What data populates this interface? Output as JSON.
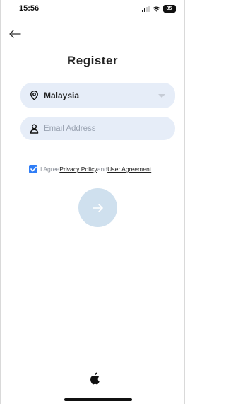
{
  "status_bar": {
    "time": "15:56",
    "battery": "85",
    "icons": [
      "signal-icon",
      "wifi-icon",
      "battery-icon"
    ]
  },
  "header": {
    "back_icon": "arrow-left-icon",
    "title": "Register"
  },
  "form": {
    "country": {
      "icon": "location-pin-icon",
      "value": "Malaysia",
      "caret_icon": "caret-down-icon"
    },
    "email": {
      "icon": "user-icon",
      "placeholder": "Email Address",
      "value": ""
    }
  },
  "agreement": {
    "checked": true,
    "prefix": "I Agree",
    "privacy_link": "Privacy Policy",
    "connector": "and",
    "user_agreement_link": "User Agreement"
  },
  "actions": {
    "next_icon": "arrow-right-icon",
    "apple_login_icon": "apple-logo-icon"
  },
  "colors": {
    "field_bg": "#e6edf8",
    "checkbox": "#2f7df6",
    "next_button": "#cfe0ee"
  }
}
